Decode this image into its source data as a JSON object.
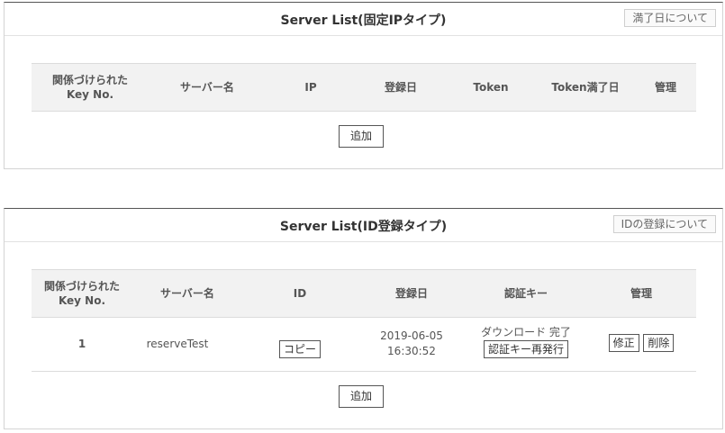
{
  "panel1": {
    "title": "Server List(固定IPタイプ)",
    "help_button": "満了日について",
    "columns": [
      "関係づけられたKey No.",
      "サーバー名",
      "IP",
      "登録日",
      "Token",
      "Token満了日",
      "管理"
    ],
    "add_button": "追加"
  },
  "panel2": {
    "title": "Server List(ID登録タイプ)",
    "help_button": "IDの登録について",
    "columns": [
      "関係づけられたKey No.",
      "サーバー名",
      "ID",
      "登録日",
      "認証キー",
      "管理"
    ],
    "rows": [
      {
        "key_no": "1",
        "server_name": "reserveTest",
        "copy_button": "コピー",
        "reg_date": "2019-06-05",
        "reg_time": "16:30:52",
        "auth_status": "ダウンロード 完了",
        "reissue_button": "認証キー再発行",
        "edit_button": "修正",
        "delete_button": "削除"
      }
    ],
    "add_button": "追加"
  }
}
